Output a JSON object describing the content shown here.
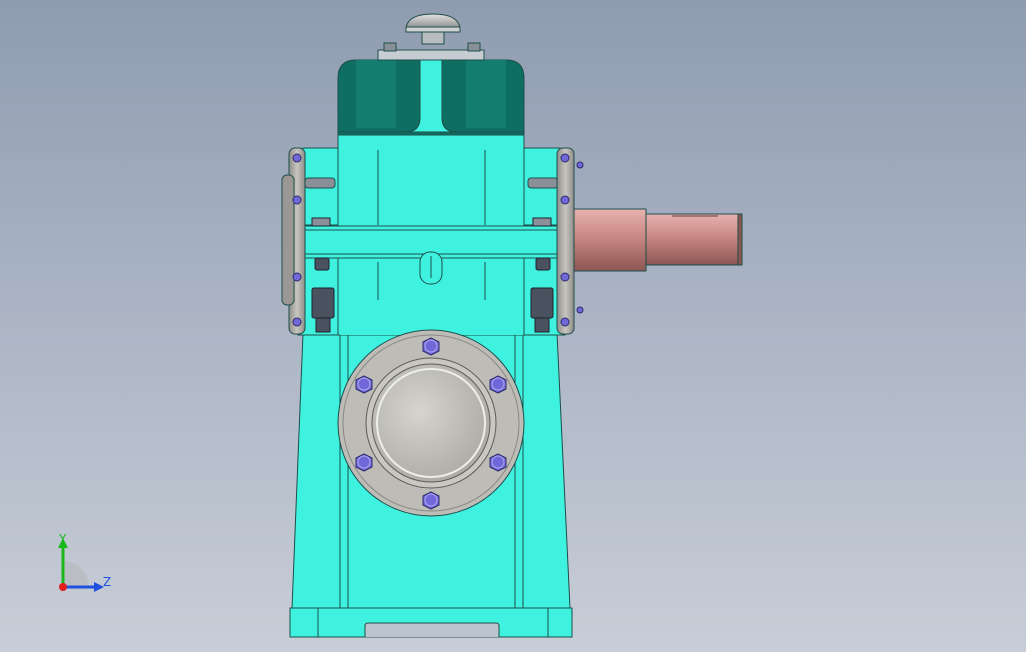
{
  "triad": {
    "y_label": "Y",
    "z_label": "Z",
    "y_color": "#18b818",
    "z_color": "#2050e0",
    "origin_color": "#e02020"
  },
  "colors": {
    "housing": "#3ff2e0",
    "housing_dark": "#0f6e62",
    "edge": "#1d4e4a",
    "flange": "#bebcb6",
    "bolt": "#7068d8",
    "shaft": "#c98884",
    "nut": "#4a5260"
  }
}
